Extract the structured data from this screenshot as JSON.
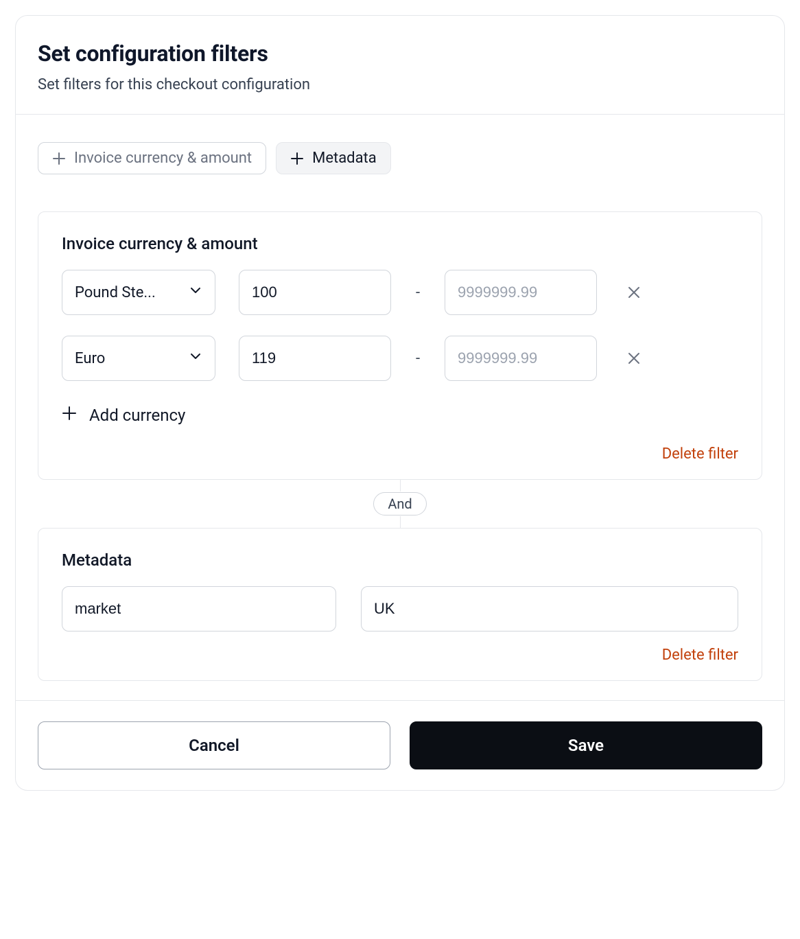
{
  "header": {
    "title": "Set configuration filters",
    "subtitle": "Set filters for this checkout configuration"
  },
  "chips": {
    "invoice": {
      "label": "Invoice currency & amount"
    },
    "metadata": {
      "label": "Metadata"
    }
  },
  "invoice_filter": {
    "title": "Invoice currency & amount",
    "rows": [
      {
        "currency": "Pound Ste...",
        "min": "100",
        "max_placeholder": "9999999.99"
      },
      {
        "currency": "Euro",
        "min": "119",
        "max_placeholder": "9999999.99"
      }
    ],
    "add_currency_label": "Add currency",
    "delete_label": "Delete filter",
    "range_separator": "-"
  },
  "connector": {
    "label": "And"
  },
  "metadata_filter": {
    "title": "Metadata",
    "key": "market",
    "value": "UK",
    "delete_label": "Delete filter"
  },
  "footer": {
    "cancel": "Cancel",
    "save": "Save"
  }
}
